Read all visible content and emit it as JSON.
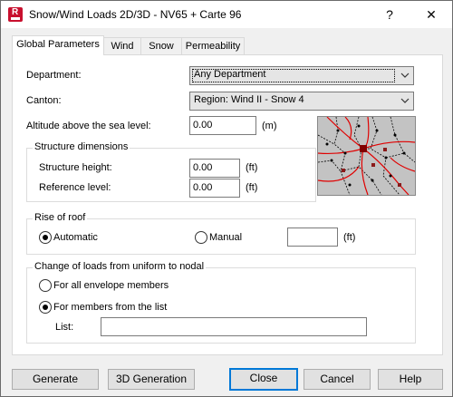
{
  "window": {
    "title": "Snow/Wind Loads 2D/3D - NV65 + Carte 96",
    "help_label": "?",
    "close_label": "✕"
  },
  "tabs": [
    {
      "label": "Global Parameters",
      "active": true
    },
    {
      "label": "Wind",
      "active": false
    },
    {
      "label": "Snow",
      "active": false
    },
    {
      "label": "Permeability",
      "active": false
    }
  ],
  "form": {
    "department_label": "Department:",
    "department_value": "Any Department",
    "canton_label": "Canton:",
    "canton_value": "Region: Wind II - Snow 4",
    "altitude_label": "Altitude above the sea level:",
    "altitude_value": "0.00",
    "altitude_unit": "(m)"
  },
  "structure": {
    "group_title": "Structure dimensions",
    "height_label": "Structure height:",
    "height_value": "0.00",
    "height_unit": "(ft)",
    "reference_label": "Reference level:",
    "reference_value": "0.00",
    "reference_unit": "(ft)"
  },
  "roof": {
    "group_title": "Rise of roof",
    "automatic_label": "Automatic",
    "automatic_selected": true,
    "manual_label": "Manual",
    "manual_selected": false,
    "manual_value": "",
    "manual_unit": "(ft)"
  },
  "loads": {
    "group_title": "Change of loads from uniform to nodal",
    "all_label": "For all envelope members",
    "all_selected": false,
    "list_option_label": "For members from the list",
    "list_option_selected": true,
    "list_label": "List:",
    "list_value": ""
  },
  "buttons": {
    "generate": "Generate",
    "generation_3d": "3D Generation",
    "close": "Close",
    "cancel": "Cancel",
    "help": "Help"
  },
  "colors": {
    "accent": "#0078d7",
    "app_icon": "#c8102e",
    "map_border_red": "#e00000"
  },
  "icons": {
    "app": "robot-app-icon",
    "dropdown": "chevron-down-icon",
    "map": "region-map-icon"
  }
}
